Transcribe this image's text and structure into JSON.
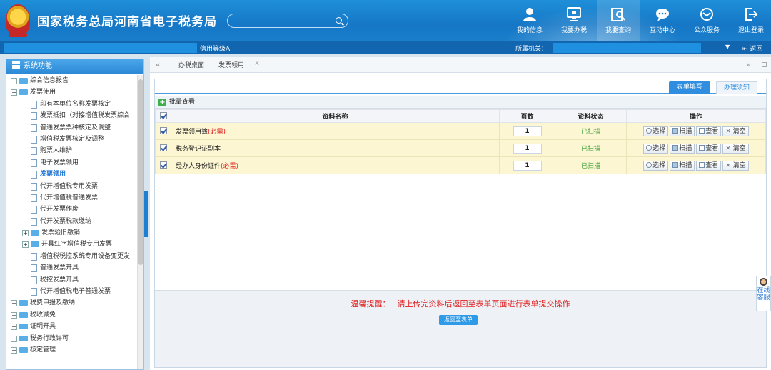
{
  "header": {
    "title": "国家税务总局河南省电子税务局",
    "nav": [
      {
        "label": "我的信息",
        "icon": "user-icon"
      },
      {
        "label": "我要办税",
        "icon": "monitor-icon"
      },
      {
        "label": "我要查询",
        "icon": "query-icon"
      },
      {
        "label": "互动中心",
        "icon": "chat-icon"
      },
      {
        "label": "公众服务",
        "icon": "service-icon"
      },
      {
        "label": "退出登录",
        "icon": "logout-icon"
      }
    ],
    "active_nav": "我要查询"
  },
  "subbar": {
    "credit": "信用等级A",
    "authority_label": "所属机关：",
    "back": "返回"
  },
  "sidebar": {
    "title": "系统功能",
    "items": [
      {
        "label": "综合信息报告",
        "type": "folder",
        "level": 0,
        "expanded": false
      },
      {
        "label": "发票使用",
        "type": "folder",
        "level": 0,
        "expanded": true
      },
      {
        "label": "印有本单位名称发票核定",
        "type": "doc",
        "level": 1
      },
      {
        "label": "发票抵扣（对接增值税发票综合",
        "type": "doc",
        "level": 1
      },
      {
        "label": "普通发票票种核定及调整",
        "type": "doc",
        "level": 1
      },
      {
        "label": "增值税发票核定及调整",
        "type": "doc",
        "level": 1
      },
      {
        "label": "购票人维护",
        "type": "doc",
        "level": 1
      },
      {
        "label": "电子发票领用",
        "type": "doc",
        "level": 1
      },
      {
        "label": "发票领用",
        "type": "doc",
        "level": 1,
        "selected": true
      },
      {
        "label": "代开增值税专用发票",
        "type": "doc",
        "level": 1
      },
      {
        "label": "代开增值税普通发票",
        "type": "doc",
        "level": 1
      },
      {
        "label": "代开发票作废",
        "type": "doc",
        "level": 1
      },
      {
        "label": "代开发票税款缴纳",
        "type": "doc",
        "level": 1
      },
      {
        "label": "发票验旧缴销",
        "type": "folder",
        "level": 1,
        "expanded": false
      },
      {
        "label": "开具红字增值税专用发票",
        "type": "folder",
        "level": 1,
        "expanded": false
      },
      {
        "label": "增值税税控系统专用设备变更发",
        "type": "doc",
        "level": 1
      },
      {
        "label": "普通发票开具",
        "type": "doc",
        "level": 1
      },
      {
        "label": "税控发票开具",
        "type": "doc",
        "level": 1
      },
      {
        "label": "代开增值税电子普通发票",
        "type": "doc",
        "level": 1
      },
      {
        "label": "税费申报及缴纳",
        "type": "folder",
        "level": 0,
        "expanded": false
      },
      {
        "label": "税收减免",
        "type": "folder",
        "level": 0,
        "expanded": false
      },
      {
        "label": "证明开具",
        "type": "folder",
        "level": 0,
        "expanded": false
      },
      {
        "label": "税务行政许可",
        "type": "folder",
        "level": 0,
        "expanded": false
      },
      {
        "label": "核定管理",
        "type": "folder",
        "level": 0,
        "expanded": false
      }
    ]
  },
  "tabs": {
    "items": [
      "办税桌面",
      "发票领用"
    ],
    "close": "×"
  },
  "subtabs": {
    "active": "表单填写",
    "inactive": "办理须知"
  },
  "batch": {
    "label": "批量查看"
  },
  "table": {
    "headers": {
      "name": "资料名称",
      "pages": "页数",
      "status": "资料状态",
      "ops": "操作"
    },
    "ops": {
      "select": "选择",
      "scan": "扫描",
      "view": "查看",
      "clear": "清空"
    },
    "rows": [
      {
        "name": "发票领用簿",
        "required": "(必需)",
        "pages": "1",
        "status": "已扫描",
        "checked": true
      },
      {
        "name": "税务登记证副本",
        "required": "",
        "pages": "1",
        "status": "已扫描",
        "checked": true
      },
      {
        "name": "经办人身份证件",
        "required": "(必需)",
        "pages": "1",
        "status": "已扫描",
        "checked": true
      }
    ]
  },
  "notice": {
    "label": "温馨提醒：",
    "text": "请上传完资料后返回至表单页面进行表单提交操作",
    "button": "返回至表单"
  },
  "float_service": {
    "label": "在线客服"
  },
  "colors": {
    "header": "#1577c6",
    "accent": "#2f8ee0",
    "required": "#e02020",
    "status": "#3aa03a",
    "row_bg": "#fdf6d2"
  }
}
